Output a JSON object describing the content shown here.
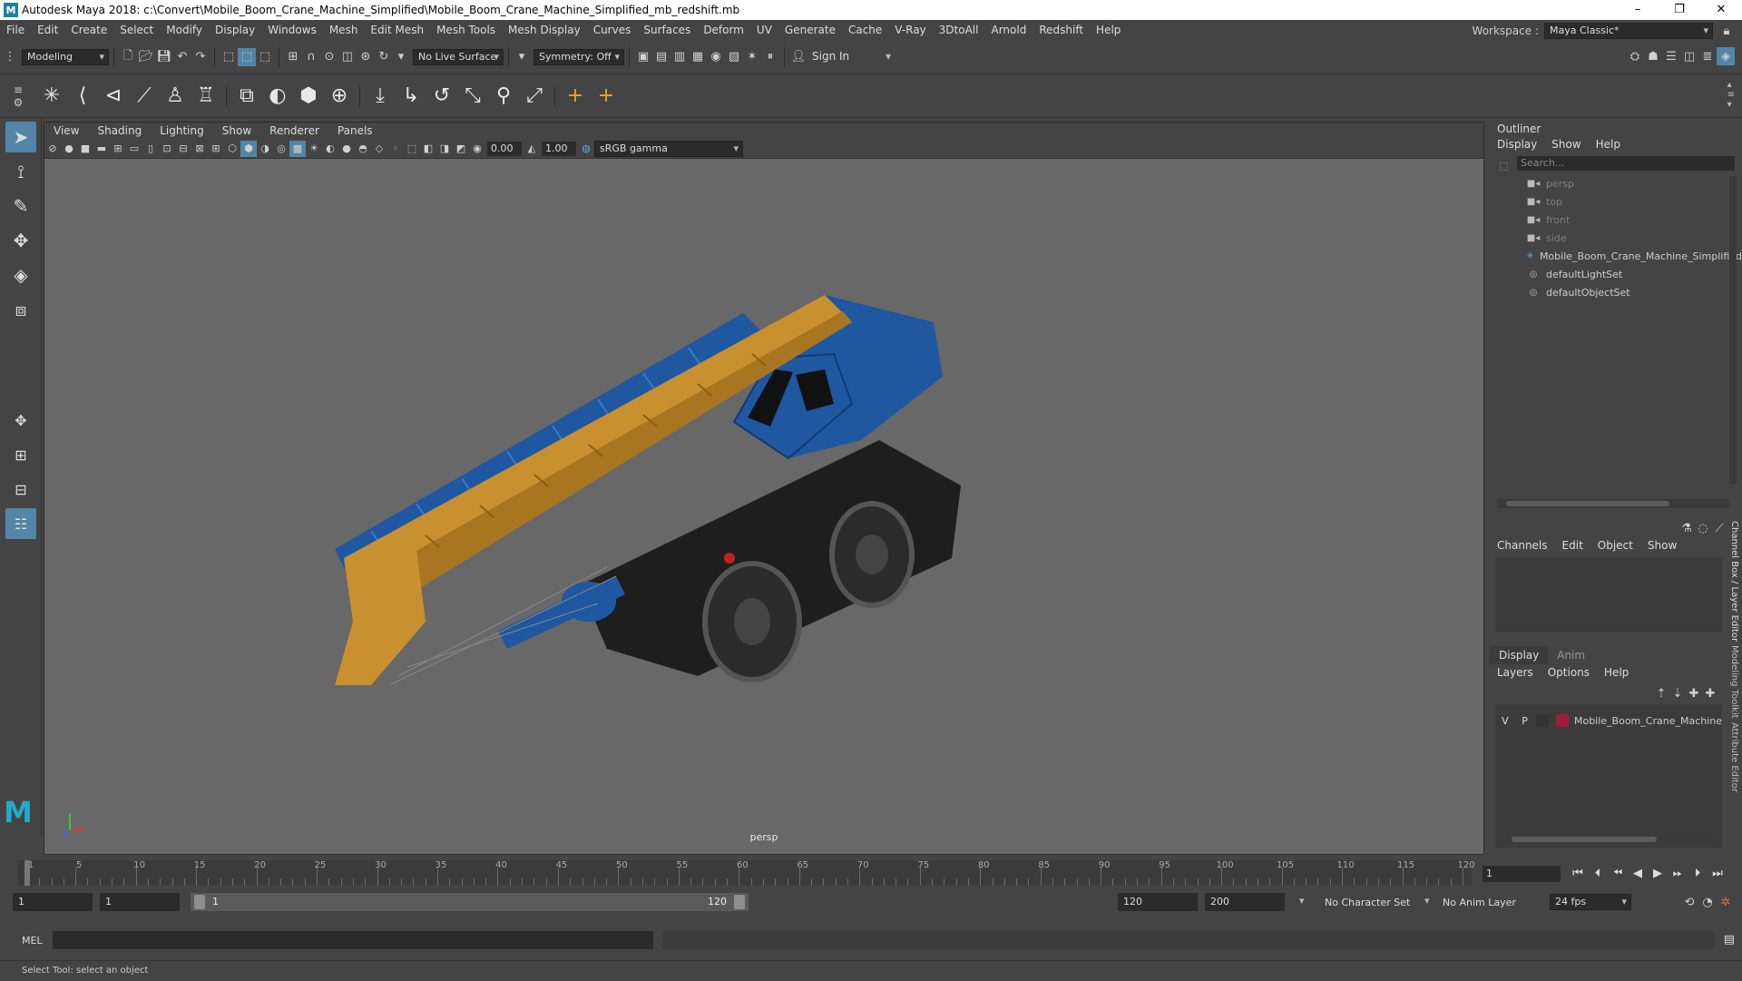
{
  "window": {
    "title": "Autodesk Maya 2018: c:\\Convert\\Mobile_Boom_Crane_Machine_Simplified\\Mobile_Boom_Crane_Machine_Simplified_mb_redshift.mb",
    "app_icon": "M"
  },
  "menubar": {
    "items": [
      "File",
      "Edit",
      "Create",
      "Select",
      "Modify",
      "Display",
      "Windows",
      "Mesh",
      "Edit Mesh",
      "Mesh Tools",
      "Mesh Display",
      "Curves",
      "Surfaces",
      "Deform",
      "UV",
      "Generate",
      "Cache",
      "V-Ray",
      "3DtoAll",
      "Arnold",
      "Redshift",
      "Help"
    ],
    "workspace_label": "Workspace :",
    "workspace_value": "Maya Classic*"
  },
  "statusline": {
    "mode": "Modeling",
    "live_surface": "No Live Surface",
    "symmetry": "Symmetry: Off",
    "sign_in": "Sign In"
  },
  "viewport": {
    "menus": [
      "View",
      "Shading",
      "Lighting",
      "Show",
      "Renderer",
      "Panels"
    ],
    "exposure": "0.00",
    "gamma": "1.00",
    "color_space": "sRGB gamma",
    "camera": "persp",
    "model_colors": {
      "boom": "#c9902f",
      "lattice": "#1f57a1",
      "chassis": "#1e1e1e"
    }
  },
  "outliner": {
    "title": "Outliner",
    "menus": [
      "Display",
      "Show",
      "Help"
    ],
    "search_placeholder": "Search...",
    "items": [
      {
        "label": "persp",
        "icon": "camera-icon",
        "dim": true
      },
      {
        "label": "top",
        "icon": "camera-icon",
        "dim": true
      },
      {
        "label": "front",
        "icon": "camera-icon",
        "dim": true
      },
      {
        "label": "side",
        "icon": "camera-icon",
        "dim": true
      },
      {
        "label": "Mobile_Boom_Crane_Machine_Simplified",
        "icon": "group-icon",
        "dim": false
      },
      {
        "label": "defaultLightSet",
        "icon": "set-icon",
        "dim": false
      },
      {
        "label": "defaultObjectSet",
        "icon": "set-icon",
        "dim": false
      }
    ]
  },
  "channelbox": {
    "menus": [
      "Channels",
      "Edit",
      "Object",
      "Show"
    ]
  },
  "layers": {
    "tabs": [
      "Display",
      "Anim"
    ],
    "menus": [
      "Layers",
      "Options",
      "Help"
    ],
    "row": {
      "v": "V",
      "p": "P",
      "name": "Mobile_Boom_Crane_Machine",
      "color": "#a01c3c"
    }
  },
  "sidetabs": [
    "Channel Box / Layer Editor",
    "Modeling Toolkit",
    "Attribute Editor"
  ],
  "timeslider": {
    "ticks": [
      "1",
      "5",
      "10",
      "15",
      "20",
      "25",
      "30",
      "35",
      "40",
      "45",
      "50",
      "55",
      "60",
      "65",
      "70",
      "75",
      "80",
      "85",
      "90",
      "95",
      "100",
      "105",
      "110",
      "115",
      "120"
    ],
    "current_frame": "1"
  },
  "range": {
    "start": "1",
    "anim_start": "1",
    "range_start": "1",
    "range_end": "120",
    "anim_end": "120",
    "end": "200",
    "character_set": "No Character Set",
    "anim_layer": "No Anim Layer",
    "fps": "24 fps"
  },
  "cmdline": {
    "label": "MEL"
  },
  "helpline": {
    "text": "Select Tool: select an object"
  }
}
